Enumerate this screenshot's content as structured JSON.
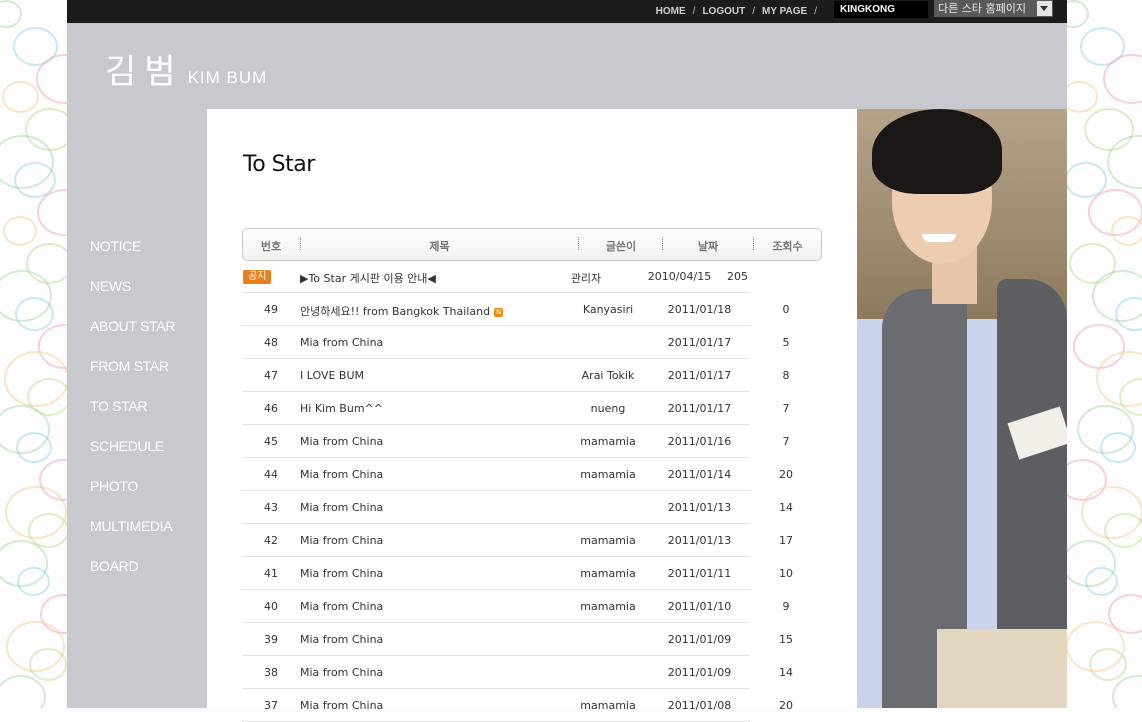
{
  "topbar": {
    "links": [
      "HOME",
      "LOGOUT",
      "MY PAGE"
    ],
    "username": "KINGKONG",
    "star_select": "다른 스타 홈페이지"
  },
  "logo": {
    "korean": "김범",
    "english": "KIM BUM"
  },
  "nav": [
    "NOTICE",
    "NEWS",
    "ABOUT STAR",
    "FROM STAR",
    "TO STAR",
    "SCHEDULE",
    "PHOTO",
    "MULTIMEDIA",
    "BOARD"
  ],
  "page_title": "To Star",
  "table": {
    "headers": [
      "번호",
      "제목",
      "글쓴이",
      "날짜",
      "조회수"
    ],
    "notice": {
      "badge": "공지",
      "title": "▶To Star 게시판 이용 안내◀",
      "author": "관리자",
      "date": "2010/04/15",
      "views": "205"
    },
    "rows": [
      {
        "num": "49",
        "title": "안녕하세요!! from Bangkok Thailand",
        "author": "Kanyasiri",
        "date": "2011/01/18",
        "views": "0",
        "new": true
      },
      {
        "num": "48",
        "title": "Mia from China",
        "author": "",
        "date": "2011/01/17",
        "views": "5"
      },
      {
        "num": "47",
        "title": "I LOVE BUM",
        "author": "Arai Tokik",
        "date": "2011/01/17",
        "views": "8"
      },
      {
        "num": "46",
        "title": "Hi Kim Bum^^",
        "author": "nueng",
        "date": "2011/01/17",
        "views": "7"
      },
      {
        "num": "45",
        "title": "Mia from China",
        "author": "mamamia",
        "date": "2011/01/16",
        "views": "7"
      },
      {
        "num": "44",
        "title": "Mia from China",
        "author": "mamamia",
        "date": "2011/01/14",
        "views": "20"
      },
      {
        "num": "43",
        "title": "Mia from China",
        "author": "",
        "date": "2011/01/13",
        "views": "14"
      },
      {
        "num": "42",
        "title": "Mia from China",
        "author": "mamamia",
        "date": "2011/01/13",
        "views": "17"
      },
      {
        "num": "41",
        "title": "Mia from China",
        "author": "mamamia",
        "date": "2011/01/11",
        "views": "10"
      },
      {
        "num": "40",
        "title": "Mia from China",
        "author": "mamamia",
        "date": "2011/01/10",
        "views": "9"
      },
      {
        "num": "39",
        "title": "Mia from China",
        "author": "",
        "date": "2011/01/09",
        "views": "15"
      },
      {
        "num": "38",
        "title": "Mia from China",
        "author": "",
        "date": "2011/01/09",
        "views": "14"
      },
      {
        "num": "37",
        "title": "Mia from China",
        "author": "mamamia",
        "date": "2011/01/08",
        "views": "20"
      }
    ]
  },
  "colors": {
    "sidebar_bg": "#c8c9ce",
    "topbar_bg": "#1c1c1c",
    "notice_badge": "#e9801b"
  }
}
